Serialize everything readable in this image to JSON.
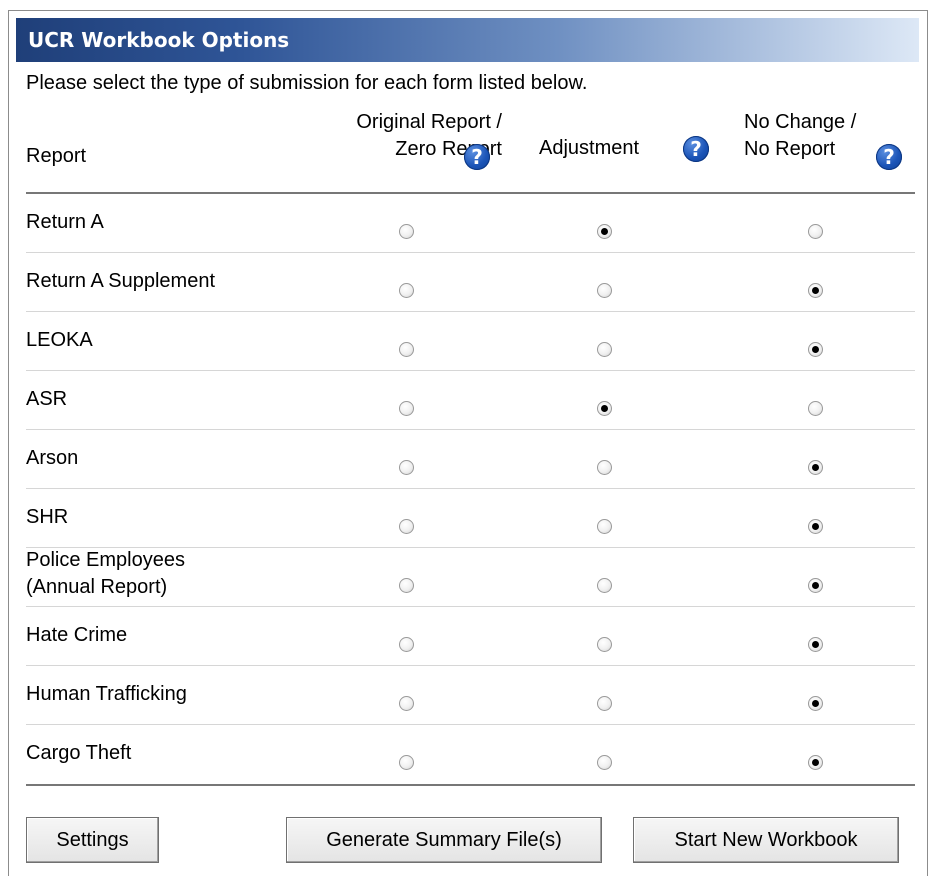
{
  "dialog": {
    "title": "UCR Workbook Options",
    "instructions": "Please select the type of submission for each form listed below."
  },
  "columns": {
    "report": "Report",
    "original_line1": "Original Report /",
    "original_line2": "Zero Report",
    "adjustment": "Adjustment",
    "nochange_line1": "No Change /",
    "nochange_line2": "No Report"
  },
  "help_icon_glyph": "?",
  "help_icon_color": "#1c55b8",
  "rows": [
    {
      "label": "Return A",
      "label2": "",
      "selected": "adjustment"
    },
    {
      "label": "Return A Supplement",
      "label2": "",
      "selected": "nochange"
    },
    {
      "label": "LEOKA",
      "label2": "",
      "selected": "nochange"
    },
    {
      "label": "ASR",
      "label2": "",
      "selected": "adjustment"
    },
    {
      "label": "Arson",
      "label2": "",
      "selected": "nochange"
    },
    {
      "label": "SHR",
      "label2": "",
      "selected": "nochange"
    },
    {
      "label": "Police Employees",
      "label2": "(Annual Report)",
      "selected": "nochange"
    },
    {
      "label": "Hate Crime",
      "label2": "",
      "selected": "nochange"
    },
    {
      "label": "Human Trafficking",
      "label2": "",
      "selected": "nochange"
    },
    {
      "label": "Cargo Theft",
      "label2": "",
      "selected": "nochange"
    }
  ],
  "buttons": {
    "settings": "Settings",
    "generate": "Generate Summary File(s)",
    "start_new": "Start New Workbook"
  }
}
